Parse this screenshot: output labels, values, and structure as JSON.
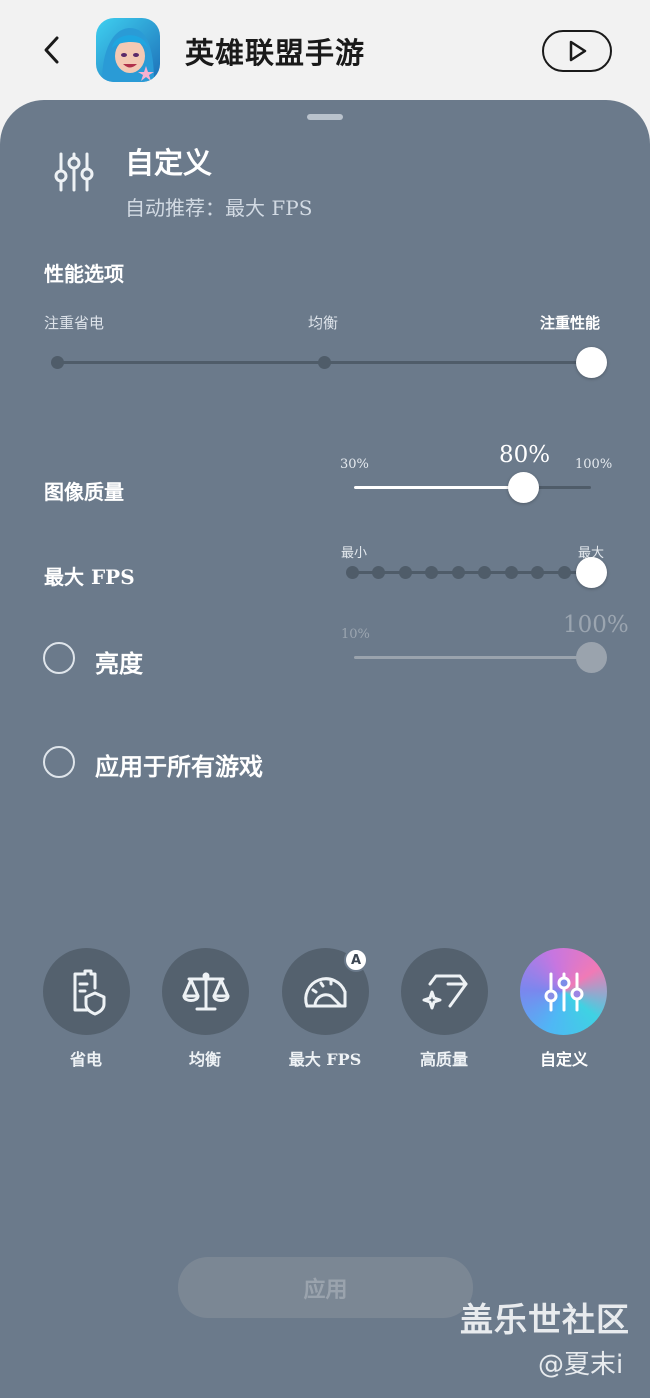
{
  "header": {
    "app_title": "英雄联盟手游"
  },
  "mode": {
    "title": "自定义",
    "subtitle": "自动推荐：最大 FPS"
  },
  "performance": {
    "section_title": "性能选项",
    "options": [
      "注重省电",
      "均衡",
      "注重性能"
    ],
    "selected_index": 2
  },
  "image_quality": {
    "label": "图像质量",
    "min_label": "30%",
    "max_label": "100%",
    "value_label": "80%",
    "value_percent": 80,
    "min_percent": 30,
    "max_percent": 100
  },
  "max_fps": {
    "label": "最大 FPS",
    "min_label": "最小",
    "max_label": "最大",
    "steps": 10,
    "selected_step": 10
  },
  "brightness": {
    "label": "亮度",
    "min_label": "10%",
    "value_label": "100%",
    "value_percent": 100,
    "checked": false,
    "disabled": true
  },
  "apply_all": {
    "label": "应用于所有游戏",
    "checked": false
  },
  "presets": [
    {
      "label": "省电",
      "icon": "battery-shield-icon"
    },
    {
      "label": "均衡",
      "icon": "balance-scale-icon"
    },
    {
      "label": "最大 FPS",
      "icon": "speedometer-icon",
      "badge": "A"
    },
    {
      "label": "高质量",
      "icon": "sparkle-diamond-icon"
    },
    {
      "label": "自定义",
      "icon": "sliders-icon",
      "active": true
    }
  ],
  "apply_button": "应用",
  "watermark": {
    "line1": "盖乐世社区",
    "line2": "@夏末i"
  },
  "colors": {
    "panel": "#6b7a8b",
    "header": "#f2f2f2",
    "track": "#4f5c69",
    "preset_bg": "#54616e"
  }
}
